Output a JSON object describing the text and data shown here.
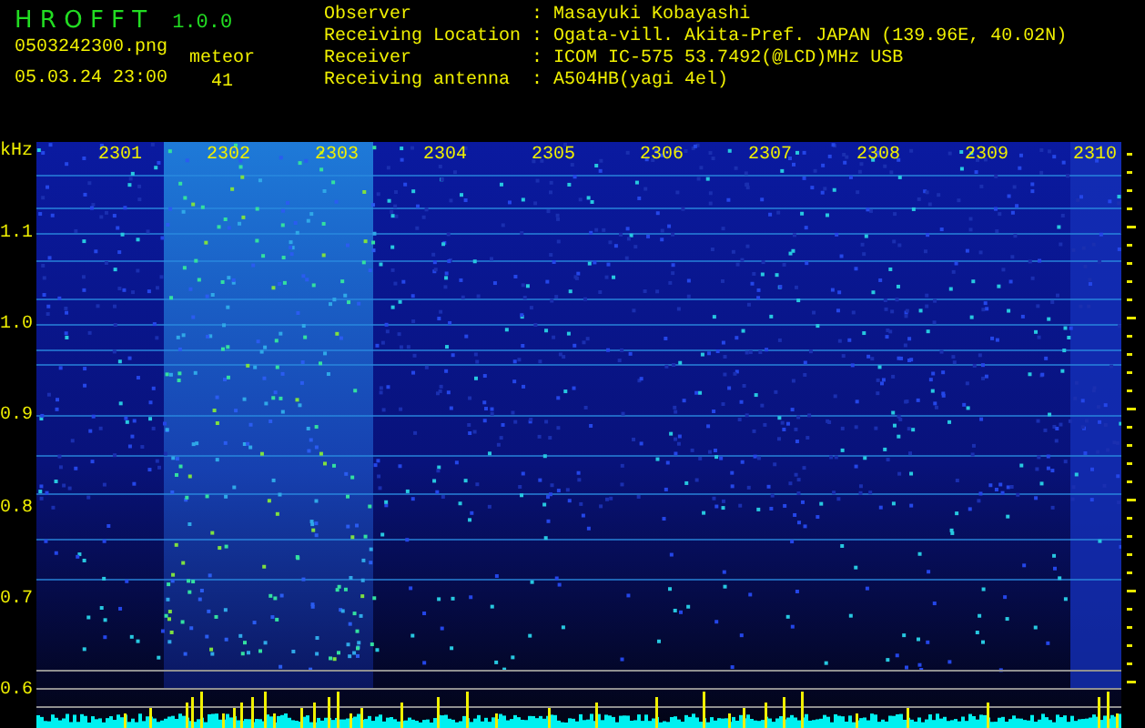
{
  "header": {
    "app_title": "H R O F F T",
    "version": "1.0.0",
    "file_name": "0503242300.png",
    "date_time": "05.03.24 23:00",
    "meteor_label": "meteor",
    "meteor_count": "41"
  },
  "info": [
    {
      "label": "Observer",
      "separator": ":",
      "value": "Masayuki Kobayashi"
    },
    {
      "label": "Receiving Location",
      "separator": ":",
      "value": "Ogata-vill. Akita-Pref. JAPAN (139.96E, 40.02N)"
    },
    {
      "label": "Receiver",
      "separator": ":",
      "value": "ICOM IC-575 53.7492(@LCD)MHz USB"
    },
    {
      "label": "Receiving antenna",
      "separator": ":",
      "value": "A504HB(yagi 4el)"
    }
  ],
  "spectrogram": {
    "unit": "kHz",
    "y_labels": [
      "1.1",
      "1.0",
      "0.9",
      "0.8",
      "0.7",
      "0.6"
    ],
    "time_labels": [
      "2301",
      "2302",
      "2303",
      "2304",
      "2305",
      "2306",
      "2307",
      "2308",
      "2309",
      "2310"
    ]
  }
}
